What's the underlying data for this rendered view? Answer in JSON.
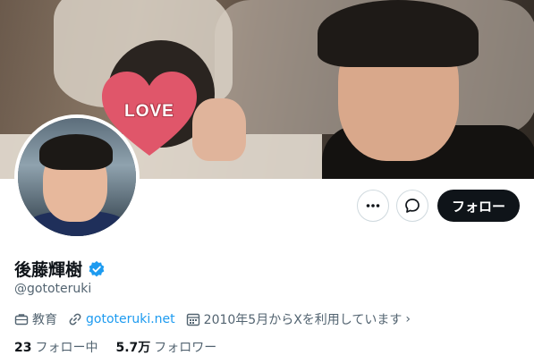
{
  "banner": {
    "sticker_text": "LOVE"
  },
  "actions": {
    "more_icon": "more-icon",
    "message_icon": "message-icon",
    "follow_label": "フォロー"
  },
  "profile": {
    "display_name": "後藤輝樹",
    "verified_icon": "verified-badge-icon",
    "verified_color": "#1d9bf0",
    "handle": "@gototeruki"
  },
  "meta": {
    "category": "教育",
    "website": "gototeruki.net",
    "joined": "2010年5月からXを利用しています"
  },
  "stats": {
    "following_count": "23",
    "following_label": "フォロー中",
    "followers_count": "5.7万",
    "followers_label": "フォロワー"
  },
  "colors": {
    "text_primary": "#0f1419",
    "text_secondary": "#536471",
    "link": "#1d9bf0",
    "button_dark": "#0f1419"
  }
}
